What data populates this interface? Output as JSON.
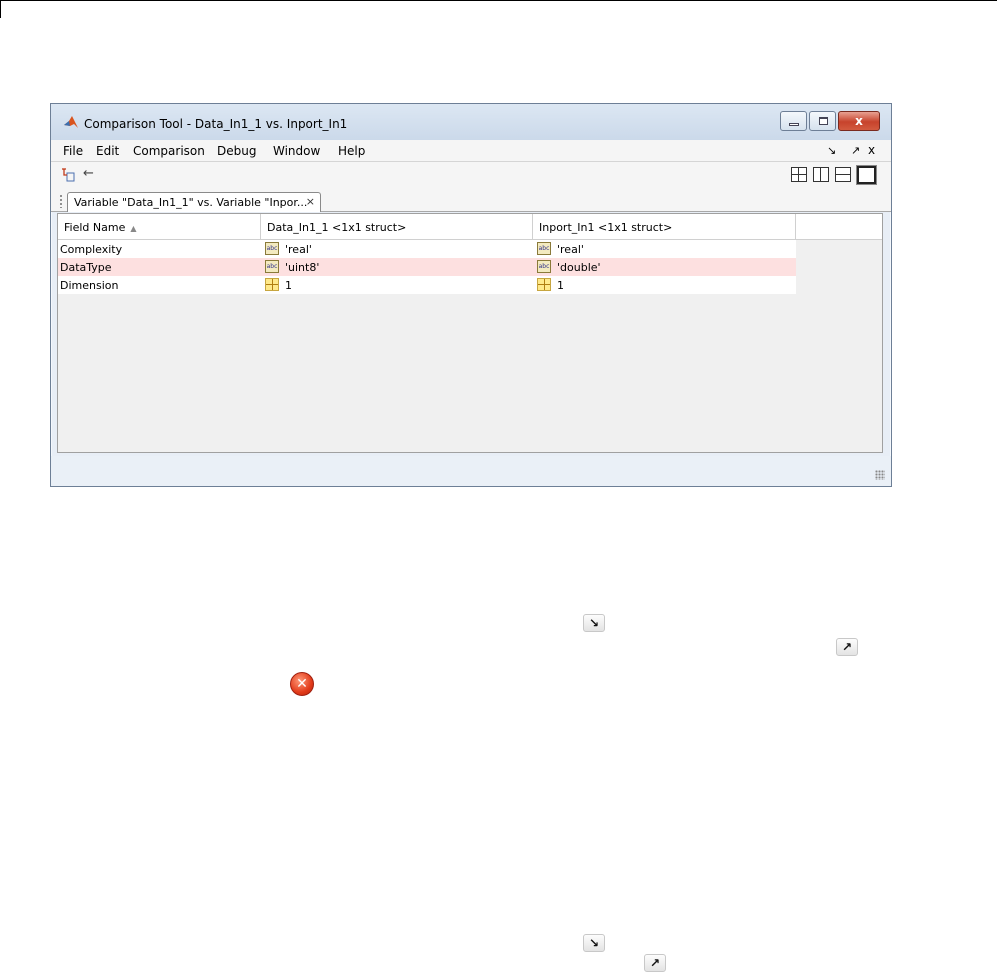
{
  "window": {
    "title": "Comparison Tool - Data_In1_1 vs. Inport_In1",
    "min_label": "",
    "max_label": "",
    "close_label": "x"
  },
  "menu": {
    "items": [
      "File",
      "Edit",
      "Comparison",
      "Debug",
      "Window",
      "Help"
    ],
    "right_undock": "↘",
    "right_dock": "↗",
    "right_close": "x"
  },
  "tab": {
    "label": "Variable \"Data_In1_1\" vs. Variable \"Inpor...",
    "close": "×"
  },
  "table": {
    "columns": [
      "Field Name",
      "Data_In1_1 <1x1 struct>",
      "Inport_In1 <1x1 struct>"
    ],
    "sort_indicator": "▲",
    "rows": [
      {
        "field": "Complexity",
        "left": "'real'",
        "right": "'real'",
        "icon": "abc-icon",
        "differs": false
      },
      {
        "field": "DataType",
        "left": "'uint8'",
        "right": "'double'",
        "icon": "abc-icon",
        "differs": true
      },
      {
        "field": "Dimension",
        "left": "1",
        "right": "1",
        "icon": "grid-icon",
        "differs": false
      }
    ]
  },
  "icons": {
    "abc": "abc",
    "back": "←",
    "undock_arrow": "↘",
    "dock_arrow": "↗",
    "error_x": "✕"
  },
  "colors": {
    "diff_row": "#fde0e0",
    "title_gradient_top": "#dce7f3",
    "close_button": "#c7432c"
  }
}
